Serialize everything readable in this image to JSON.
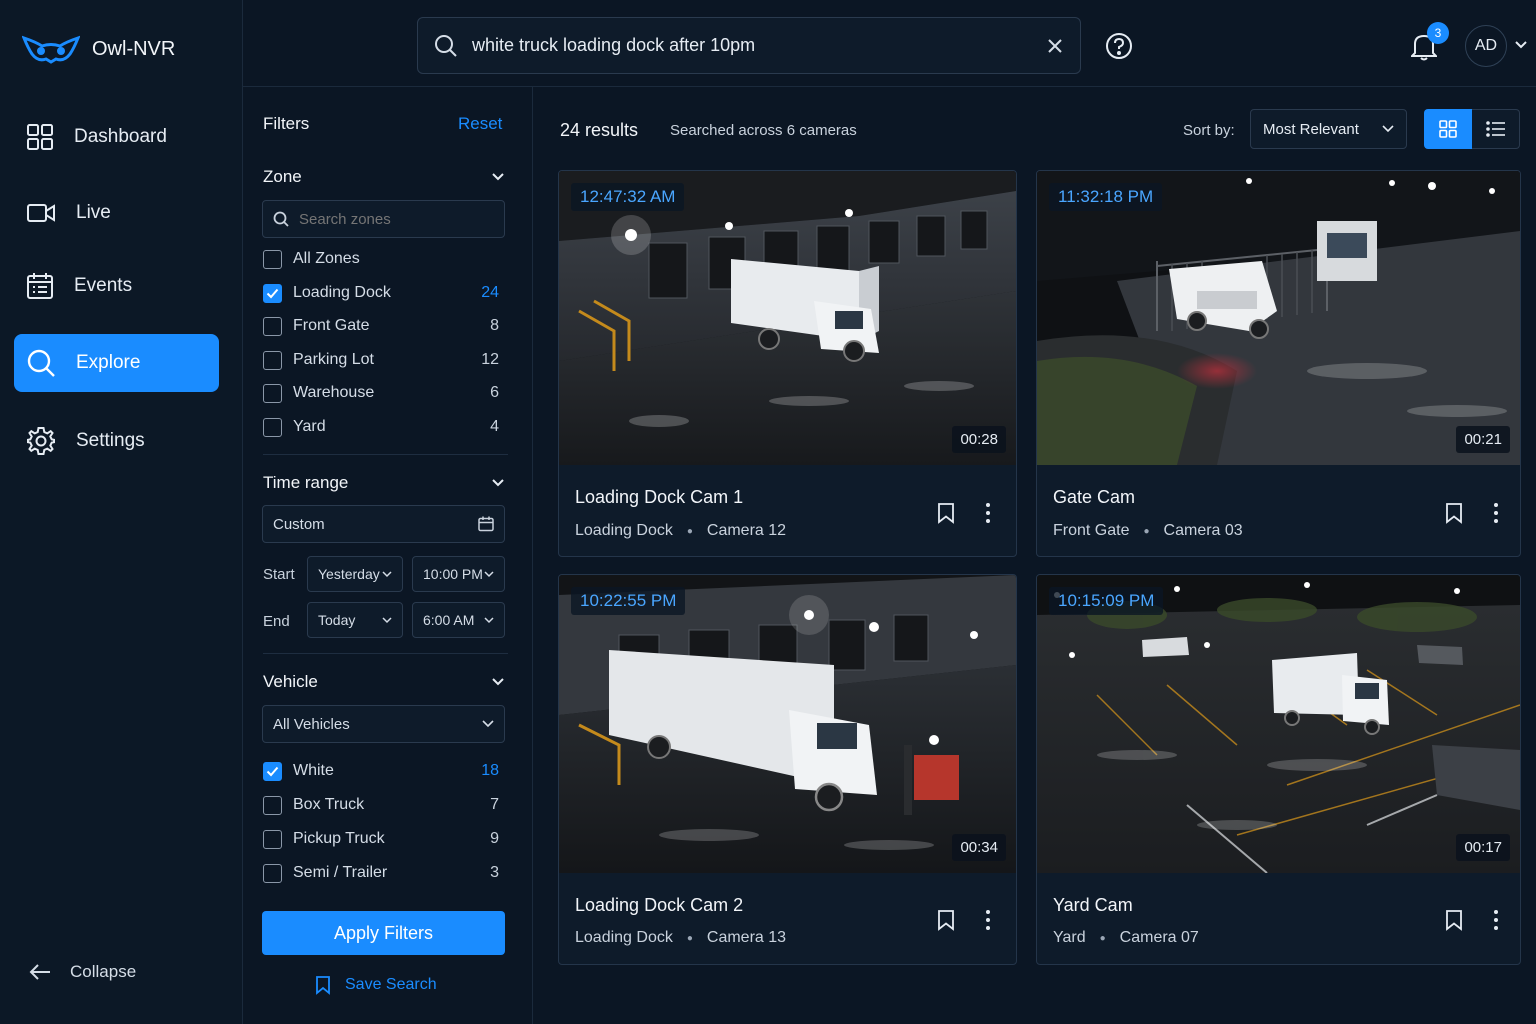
{
  "app": {
    "name": "Owl-NVR"
  },
  "nav": {
    "items": [
      {
        "label": "Dashboard"
      },
      {
        "label": "Live"
      },
      {
        "label": "Events"
      },
      {
        "label": "Explore"
      },
      {
        "label": "Settings"
      }
    ],
    "collapse_label": "Collapse"
  },
  "search": {
    "value": "white truck loading dock after 10pm"
  },
  "header": {
    "notification_count": "3",
    "avatar_initials": "AD"
  },
  "filters": {
    "title": "Filters",
    "reset_label": "Reset",
    "zone": {
      "title": "Zone",
      "search_placeholder": "Search zones",
      "options": [
        {
          "label": "All Zones",
          "count": "",
          "checked": false
        },
        {
          "label": "Loading Dock",
          "count": "24",
          "checked": true
        },
        {
          "label": "Front Gate",
          "count": "8",
          "checked": false
        },
        {
          "label": "Parking Lot",
          "count": "12",
          "checked": false
        },
        {
          "label": "Warehouse",
          "count": "6",
          "checked": false
        },
        {
          "label": "Yard",
          "count": "4",
          "checked": false
        }
      ]
    },
    "time_range": {
      "title": "Time range",
      "preset": "Custom",
      "start_label": "Start",
      "start_day": "Yesterday",
      "start_time": "10:00 PM",
      "end_label": "End",
      "end_day": "Today",
      "end_time": "6:00 AM"
    },
    "vehicle": {
      "title": "Vehicle",
      "selected": "All Vehicles",
      "options": [
        {
          "label": "White",
          "count": "18",
          "checked": true
        },
        {
          "label": "Box Truck",
          "count": "7",
          "checked": false
        },
        {
          "label": "Pickup Truck",
          "count": "9",
          "checked": false
        },
        {
          "label": "Semi / Trailer",
          "count": "3",
          "checked": false
        }
      ]
    },
    "apply_label": "Apply Filters",
    "save_label": "Save Search"
  },
  "results": {
    "count_label": "24 results",
    "subtitle": "Searched across 6 cameras",
    "sort_label": "Sort by:",
    "sort_value": "Most Relevant",
    "cards": [
      {
        "timestamp": "12:47:32 AM",
        "duration": "00:28",
        "title": "Loading Dock Cam 1",
        "zone": "Loading Dock",
        "camera": "Camera 12"
      },
      {
        "timestamp": "11:32:18 PM",
        "duration": "00:21",
        "title": "Gate Cam",
        "zone": "Front Gate",
        "camera": "Camera 03"
      },
      {
        "timestamp": "10:22:55 PM",
        "duration": "00:34",
        "title": "Loading Dock Cam 2",
        "zone": "Loading Dock",
        "camera": "Camera 13"
      },
      {
        "timestamp": "10:15:09 PM",
        "duration": "00:17",
        "title": "Yard Cam",
        "zone": "Yard",
        "camera": "Camera 07"
      }
    ]
  },
  "colors": {
    "accent": "#1a8cff",
    "background": "#0b1624",
    "panel": "#0e1b2a"
  }
}
